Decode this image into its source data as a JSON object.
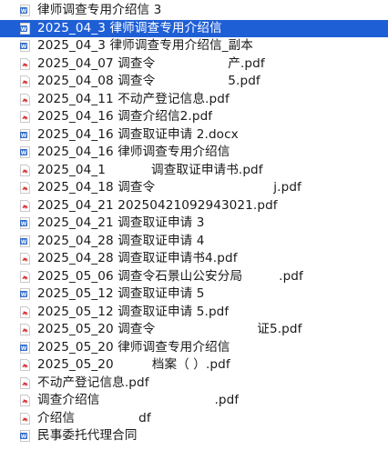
{
  "colors": {
    "selection": "#1f5fd6",
    "word_icon": "#2b67c6",
    "pdf_icon": "#d9363e"
  },
  "files": [
    {
      "icon": "word-doc-icon",
      "pre": "律师调查专用介绍信 3",
      "post": "",
      "gap": 0,
      "selected": false
    },
    {
      "icon": "word-doc-icon",
      "pre": "2025_04_3 律师调查专用介绍信",
      "post": "",
      "gap": 0,
      "selected": true
    },
    {
      "icon": "word-doc-icon",
      "pre": "2025_04_3 律师调查专用介绍信_副本",
      "post": "",
      "gap": 0,
      "selected": false
    },
    {
      "icon": "pdf-icon",
      "pre": "2025_04_07 调查令",
      "post": "产.pdf",
      "gap": 80,
      "selected": false
    },
    {
      "icon": "pdf-icon",
      "pre": "2025_04_08 调查令",
      "post": "5.pdf",
      "gap": 80,
      "selected": false
    },
    {
      "icon": "pdf-icon",
      "pre": "2025_04_11 不动产登记信息.pdf",
      "post": "",
      "gap": 0,
      "selected": false
    },
    {
      "icon": "pdf-icon",
      "pre": "2025_04_16 调查介绍信2.pdf",
      "post": "",
      "gap": 0,
      "selected": false
    },
    {
      "icon": "word-doc-icon",
      "pre": "2025_04_16 调查取证申请 2.docx",
      "post": "",
      "gap": 0,
      "selected": false
    },
    {
      "icon": "word-doc-icon",
      "pre": "2025_04_16 律师调查专用介绍信",
      "post": "",
      "gap": 0,
      "selected": false
    },
    {
      "icon": "pdf-icon",
      "pre": "2025_04_1",
      "post": "调查取证申请书.pdf",
      "gap": 50,
      "selected": false
    },
    {
      "icon": "pdf-icon",
      "pre": "2025_04_18 调查令",
      "post": "j.pdf",
      "gap": 130,
      "selected": false
    },
    {
      "icon": "pdf-icon",
      "pre": "2025_04_21 20250421092943021.pdf",
      "post": "",
      "gap": 0,
      "selected": false
    },
    {
      "icon": "word-doc-icon",
      "pre": "2025_04_21 调查取证申请 3",
      "post": "",
      "gap": 0,
      "selected": false
    },
    {
      "icon": "word-doc-icon",
      "pre": "2025_04_28 调查取证申请 4",
      "post": "",
      "gap": 0,
      "selected": false
    },
    {
      "icon": "pdf-icon",
      "pre": "2025_04_28 调查取证申请书4.pdf",
      "post": "",
      "gap": 0,
      "selected": false
    },
    {
      "icon": "pdf-icon",
      "pre": "2025_05_06 调查令石景山公安分局",
      "post": ".pdf",
      "gap": 40,
      "selected": false
    },
    {
      "icon": "word-doc-icon",
      "pre": "2025_05_12 调查取证申请 5",
      "post": "",
      "gap": 0,
      "selected": false
    },
    {
      "icon": "pdf-icon",
      "pre": "2025_05_12 调查取证申请 5.pdf",
      "post": "",
      "gap": 0,
      "selected": false
    },
    {
      "icon": "pdf-icon",
      "pre": "2025_05_20 调查令",
      "post": "证5.pdf",
      "gap": 112,
      "selected": false
    },
    {
      "icon": "word-doc-icon",
      "pre": "2025_05_20 律师调查专用介绍信",
      "post": "",
      "gap": 0,
      "selected": false
    },
    {
      "icon": "pdf-icon",
      "pre": "2025_05_20",
      "post": "档案（     ）.pdf",
      "gap": 42,
      "selected": false
    },
    {
      "icon": "pdf-icon",
      "pre": "不动产登记信息.pdf",
      "post": "",
      "gap": 0,
      "selected": false
    },
    {
      "icon": "pdf-icon",
      "pre": "调查介绍信",
      "post": ".pdf",
      "gap": 126,
      "selected": false
    },
    {
      "icon": "pdf-icon",
      "pre": "介绍信",
      "post": "df",
      "gap": 70,
      "selected": false
    },
    {
      "icon": "word-doc-icon",
      "pre": "民事委托代理合同",
      "post": "",
      "gap": 0,
      "selected": false
    }
  ]
}
